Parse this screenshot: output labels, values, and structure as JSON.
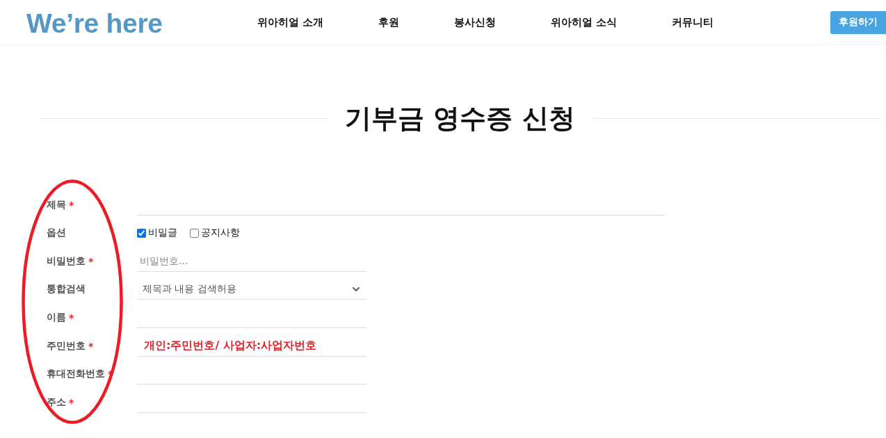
{
  "header": {
    "logo": "We’re here",
    "nav": [
      "위아히얼 소개",
      "후원",
      "봉사신청",
      "위아히얼 소식",
      "커뮤니티"
    ],
    "donate_button": "후원하기"
  },
  "page_title": "기부금 영수증 신청",
  "form": {
    "rows": [
      {
        "kind": "title",
        "label": "제목",
        "required_mark": "*"
      },
      {
        "kind": "options",
        "label": "옵션",
        "options": [
          {
            "label": "비밀글",
            "checked": true
          },
          {
            "label": "공지사항",
            "checked": false
          }
        ]
      },
      {
        "kind": "password",
        "label": "비밀번호",
        "required_mark": "*",
        "placeholder": "비밀번호...",
        "emphasized": false
      },
      {
        "kind": "select",
        "label": "통합검색",
        "value": "제목과 내용 검색허용"
      },
      {
        "kind": "text",
        "label": "이름",
        "required_mark": "*"
      },
      {
        "kind": "text",
        "label": "주민번호",
        "required_mark": "*",
        "placeholder": "개인:주민번호/ 사업자:사업자번호",
        "emphasized": true
      },
      {
        "kind": "text",
        "label": "휴대전화번호",
        "required_mark": "*"
      },
      {
        "kind": "text",
        "label": "주소",
        "required_mark": "*"
      }
    ]
  },
  "annotation": {
    "kind": "ellipse"
  }
}
